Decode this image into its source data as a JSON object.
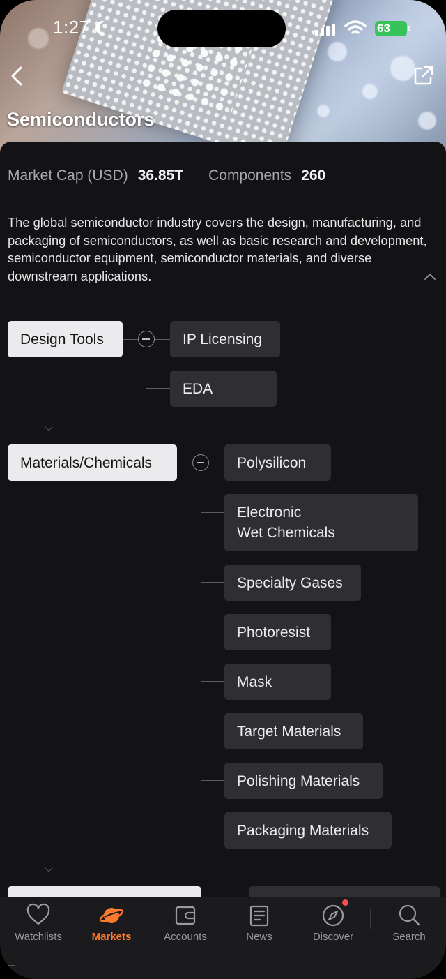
{
  "status_bar": {
    "time": "1:27",
    "battery": "63"
  },
  "header": {
    "title": "Semiconductors"
  },
  "stats": {
    "market_cap_label": "Market Cap (USD)",
    "market_cap_value": "36.85T",
    "components_label": "Components",
    "components_value": "260"
  },
  "description": "The global semiconductor industry covers the design, manufacturing, and packaging of semiconductors, as well as basic research and development, semiconductor equipment, semiconductor materials, and diverse downstream applications.",
  "tree": {
    "design_tools": {
      "label": "Design Tools",
      "children": [
        "IP Licensing",
        "EDA"
      ]
    },
    "materials": {
      "label": "Materials/Chemicals",
      "children": [
        "Polysilicon",
        "Electronic\nWet Chemicals",
        "Specialty Gases",
        "Photoresist",
        "Mask",
        "Target Materials",
        "Polishing Materials",
        "Packaging Materials"
      ]
    }
  },
  "tabs": [
    {
      "label": "Watchlists",
      "icon": "heart-icon",
      "active": false
    },
    {
      "label": "Markets",
      "icon": "planet-icon",
      "active": true
    },
    {
      "label": "Accounts",
      "icon": "wallet-icon",
      "active": false
    },
    {
      "label": "News",
      "icon": "news-icon",
      "active": false
    },
    {
      "label": "Discover",
      "icon": "compass-icon",
      "active": false
    },
    {
      "label": "Search",
      "icon": "search-icon",
      "active": false
    }
  ],
  "colors": {
    "accent": "#ff7a2f",
    "background": "#131315",
    "parent_node": "#ebebed",
    "child_node": "#2e2e33",
    "badge": "#ff4d4f"
  }
}
